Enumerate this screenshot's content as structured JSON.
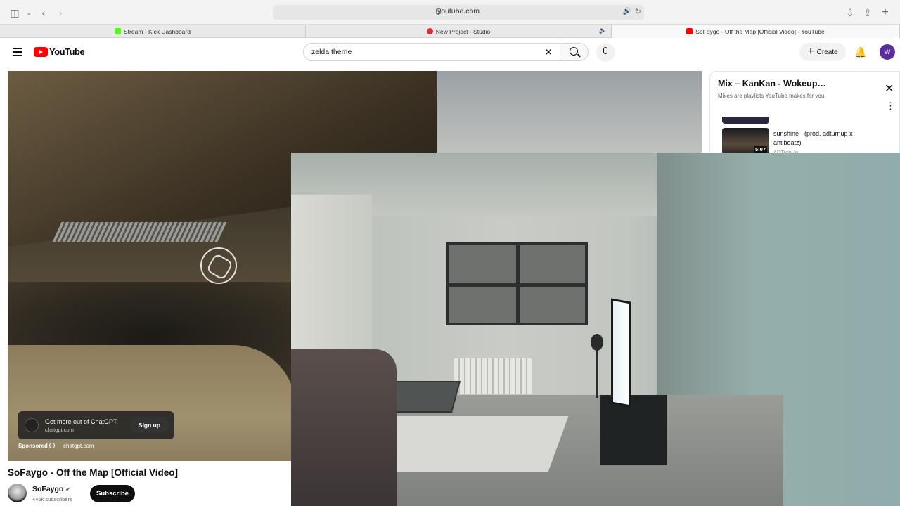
{
  "browser": {
    "url": "youtube.com",
    "tabs": [
      {
        "label": "Stream - Kick Dashboard",
        "favicon_color": "#53fc18"
      },
      {
        "label": "New Project - Studio",
        "favicon_color": "#e0282f"
      },
      {
        "label": "SoFaygo - Off the Map [Official Video] - YouTube",
        "favicon_color": "#ff0000"
      }
    ]
  },
  "header": {
    "logo_text": "YouTube",
    "search_value": "zelda theme",
    "create_label": "Create",
    "avatar_letter": "W"
  },
  "ad": {
    "title": "Get more out of ChatGPT.",
    "domain": "chatgpt.com",
    "signup_label": "Sign up",
    "sponsored_label": "Sponsored",
    "footer_domain": "chatgpt.com"
  },
  "mix": {
    "title": "Mix – KanKan - Wokeup…",
    "subtitle": "Mixes are playlists YouTube makes for you",
    "item": {
      "title": "sunshine - (prod. adturnup x antibeatz)",
      "duration": "5:07",
      "channel": "ADTurnUp"
    }
  },
  "video": {
    "title": "SoFaygo - Off the Map [Official Video]",
    "channel": "SoFaygo",
    "subscribers": "446k subscribers",
    "subscribe_label": "Subscribe"
  }
}
